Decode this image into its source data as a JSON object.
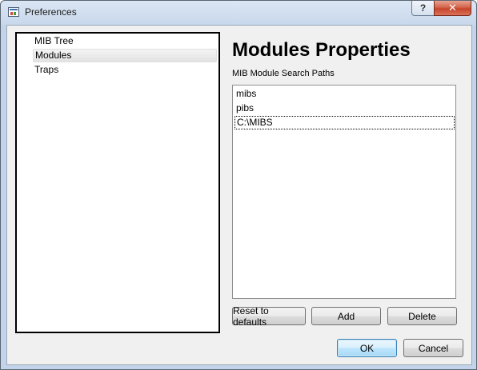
{
  "window": {
    "title": "Preferences",
    "help_label": "?",
    "close_label": "✕"
  },
  "tree": {
    "items": [
      {
        "label": "MIB Tree",
        "selected": false
      },
      {
        "label": "Modules",
        "selected": true
      },
      {
        "label": "Traps",
        "selected": false
      }
    ]
  },
  "modules": {
    "title": "Modules Properties",
    "search_paths_label": "MIB Module Search Paths",
    "paths": [
      "mibs",
      "pibs",
      "C:\\MIBS"
    ],
    "current_path_index": 2
  },
  "buttons": {
    "reset_label": "Reset to defaults",
    "add_label": "Add",
    "delete_label": "Delete",
    "ok_label": "OK",
    "cancel_label": "Cancel"
  }
}
